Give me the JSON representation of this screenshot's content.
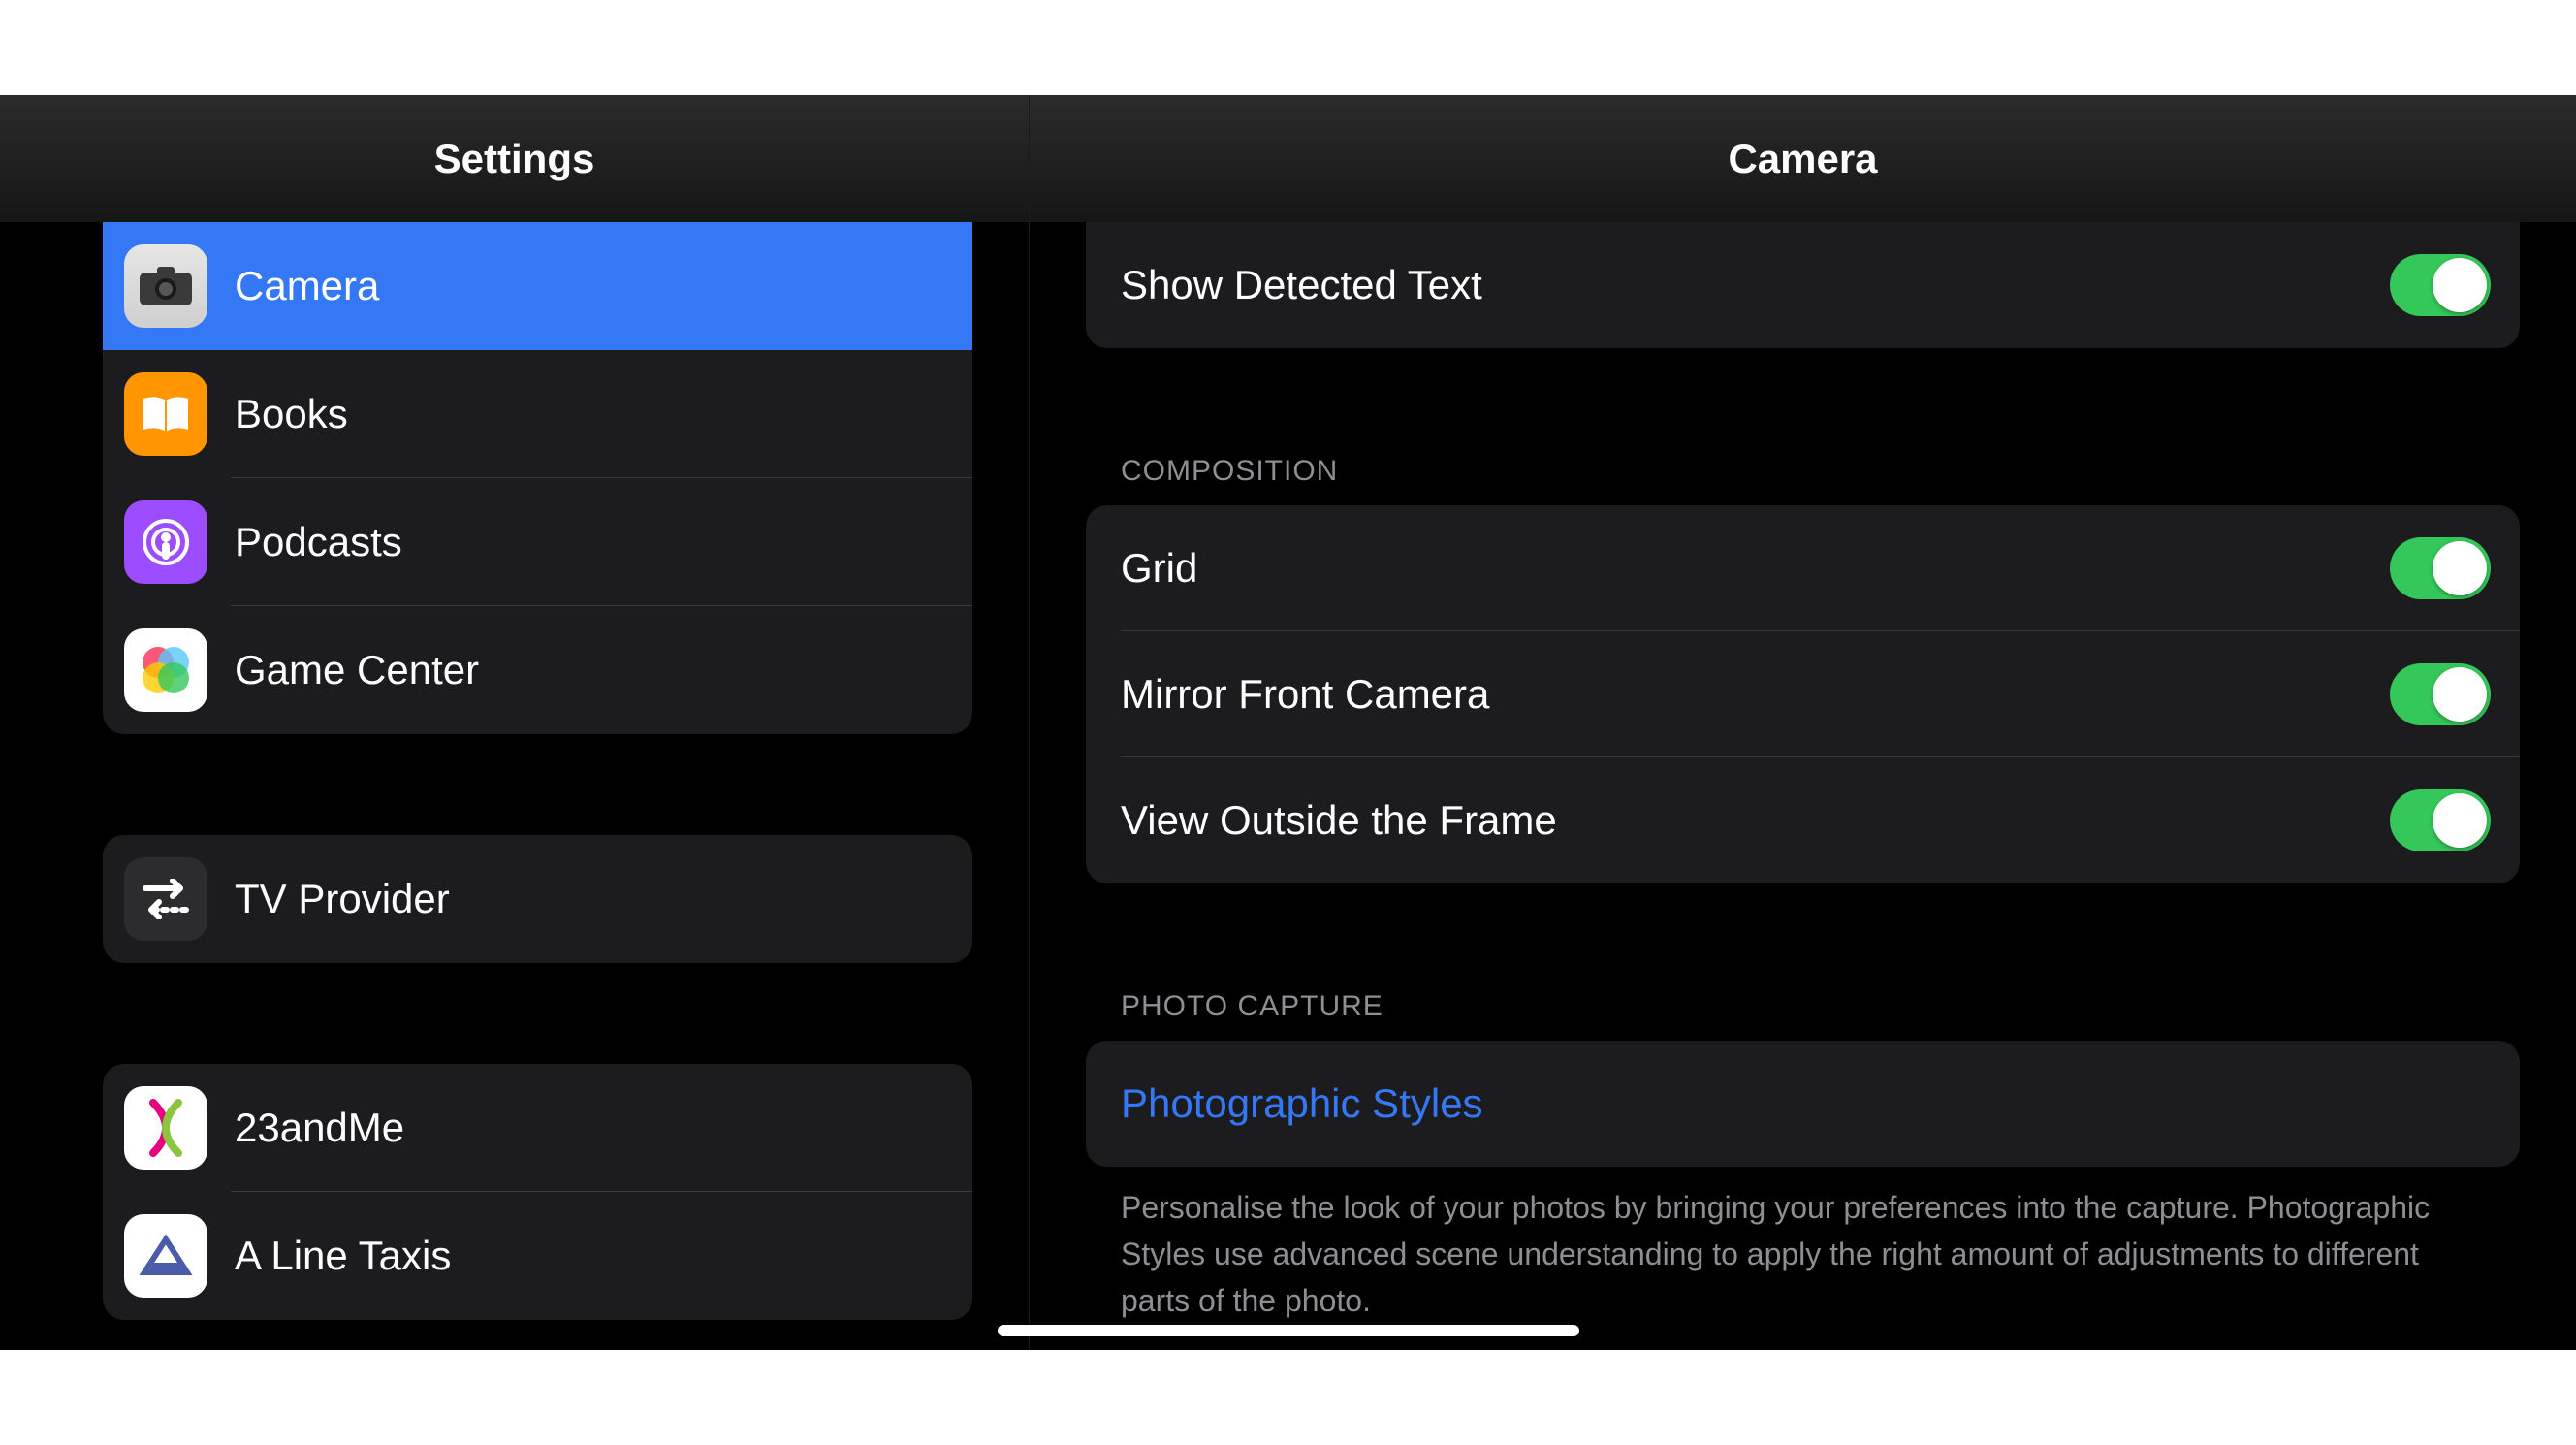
{
  "sidebar": {
    "title": "Settings",
    "groups": [
      {
        "items": [
          {
            "label": "Camera",
            "icon": "camera",
            "selected": true
          },
          {
            "label": "Books",
            "icon": "books"
          },
          {
            "label": "Podcasts",
            "icon": "podcasts"
          },
          {
            "label": "Game Center",
            "icon": "gamecenter"
          }
        ]
      },
      {
        "items": [
          {
            "label": "TV Provider",
            "icon": "tvprovider"
          }
        ]
      },
      {
        "items": [
          {
            "label": "23andMe",
            "icon": "23andme"
          },
          {
            "label": "A Line Taxis",
            "icon": "alinetaxis"
          }
        ]
      }
    ]
  },
  "detail": {
    "title": "Camera",
    "top_row": {
      "label": "Show Detected Text",
      "on": true
    },
    "composition": {
      "header": "COMPOSITION",
      "rows": [
        {
          "label": "Grid",
          "on": true
        },
        {
          "label": "Mirror Front Camera",
          "on": true
        },
        {
          "label": "View Outside the Frame",
          "on": true
        }
      ]
    },
    "photo_capture": {
      "header": "PHOTO CAPTURE",
      "link": "Photographic Styles",
      "footer": "Personalise the look of your photos by bringing your preferences into the capture. Photographic Styles use advanced scene understanding to apply the right amount of adjustments to different parts of the photo."
    }
  }
}
